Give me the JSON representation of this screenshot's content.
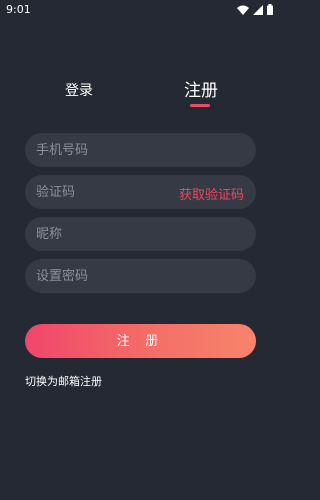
{
  "status_bar": {
    "time": "9:01",
    "icons": [
      "wifi-icon",
      "cellular-signal-icon",
      "battery-icon"
    ]
  },
  "tabs": {
    "login": "登录",
    "register": "注册",
    "active": "register"
  },
  "form": {
    "phone_placeholder": "手机号码",
    "code_placeholder": "验证码",
    "get_code_label": "获取验证码",
    "nickname_placeholder": "昵称",
    "password_placeholder": "设置密码"
  },
  "actions": {
    "register_label": "注 册",
    "switch_email_label": "切换为邮箱注册"
  },
  "colors": {
    "background": "#252933",
    "field": "#363a45",
    "accent": "#ea4c62",
    "button_gradient_start": "#f0466a",
    "button_gradient_end": "#f7846b"
  }
}
